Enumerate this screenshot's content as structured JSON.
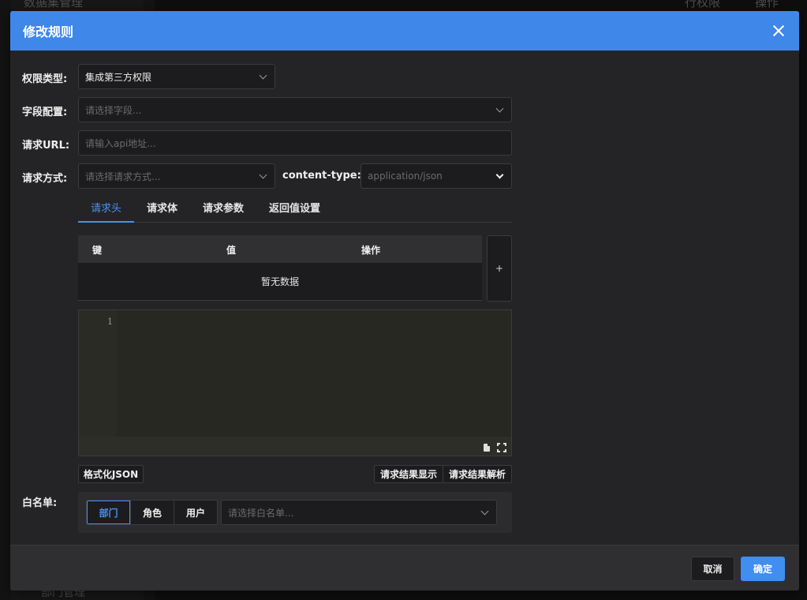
{
  "background": {
    "sidebar_top_text": "数据集管理",
    "sidebar_bottom_text": "部门管理",
    "header_col_1": "行权限",
    "header_col_2": "操作"
  },
  "modal": {
    "title": "修改规则",
    "fields": {
      "permission_type": {
        "label": "权限类型:",
        "value": "集成第三方权限"
      },
      "field_config": {
        "label": "字段配置:",
        "placeholder": "请选择字段..."
      },
      "request_url": {
        "label": "请求URL:",
        "placeholder": "请输入api地址..."
      },
      "request_method": {
        "label": "请求方式:",
        "placeholder": "请选择请求方式..."
      },
      "content_type": {
        "label": "content-type:",
        "value": "application/json"
      }
    },
    "tabs": [
      {
        "label": "请求头",
        "active": true
      },
      {
        "label": "请求体",
        "active": false
      },
      {
        "label": "请求参数",
        "active": false
      },
      {
        "label": "返回值设置",
        "active": false
      }
    ],
    "table": {
      "columns": [
        "键",
        "值",
        "操作"
      ],
      "empty_text": "暂无数据",
      "add_label": "+"
    },
    "editor": {
      "line_numbers": [
        "1"
      ]
    },
    "buttons": {
      "format_json": "格式化JSON",
      "show_result": "请求结果显示",
      "parse_result": "请求结果解析"
    },
    "whitelist": {
      "label": "白名单:",
      "segments": [
        {
          "label": "部门",
          "active": true
        },
        {
          "label": "角色",
          "active": false
        },
        {
          "label": "用户",
          "active": false
        }
      ],
      "placeholder": "请选择白名单..."
    },
    "footer": {
      "cancel": "取消",
      "confirm": "确定"
    }
  },
  "colors": {
    "accent": "#4087ea",
    "primary_button": "#3f8ef0",
    "active_tab": "#4a8ff0"
  }
}
